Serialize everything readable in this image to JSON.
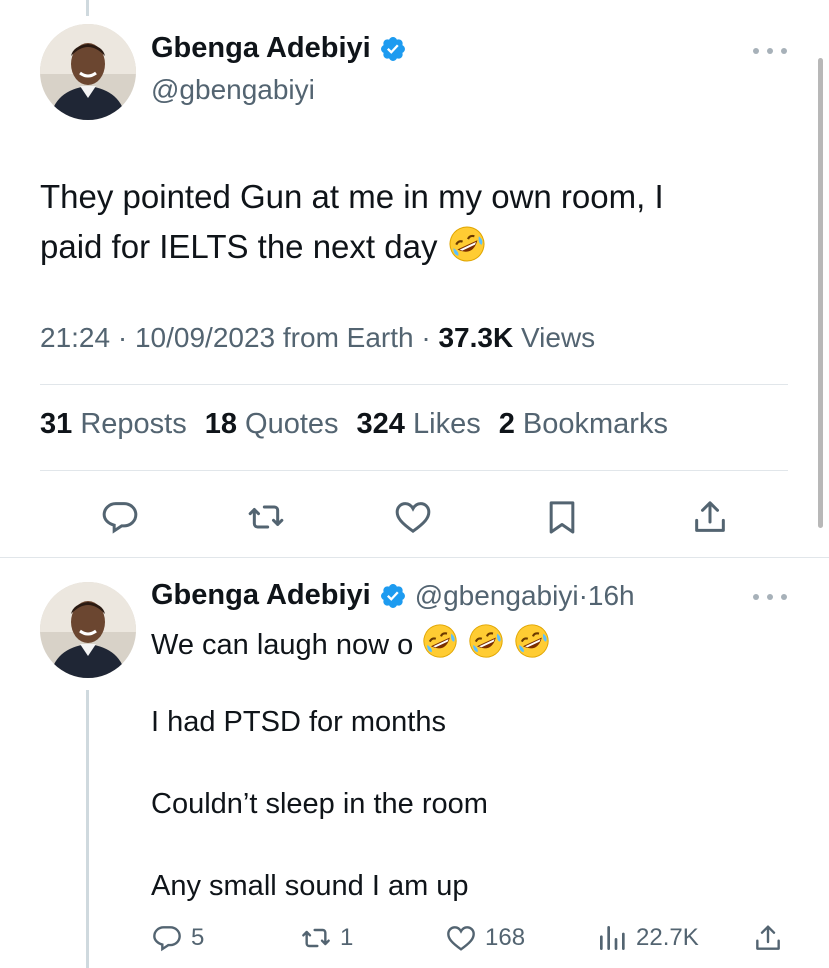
{
  "main_tweet": {
    "author": {
      "name": "Gbenga Adebiyi",
      "handle": "@gbengabiyi",
      "verified": true
    },
    "text_line1": "They pointed Gun at me in my own room, I",
    "text_line2": "paid for IELTS the next day",
    "emoji": "rolling-on-the-floor-laughing",
    "time": "21:24",
    "date": "10/09/2023",
    "source": "from Earth",
    "views_count": "37.3K",
    "views_label": "Views",
    "stats": {
      "reposts_count": "31",
      "reposts_label": "Reposts",
      "quotes_count": "18",
      "quotes_label": "Quotes",
      "likes_count": "324",
      "likes_label": "Likes",
      "bookmarks_count": "2",
      "bookmarks_label": "Bookmarks"
    }
  },
  "reply_tweet": {
    "author": {
      "name": "Gbenga Adebiyi",
      "handle": "@gbengabiyi",
      "verified": true
    },
    "age": "16h",
    "line1": "We can laugh now o",
    "line2": "I had PTSD for months",
    "line3": "Couldn’t sleep in the room",
    "line4": "Any small sound I am up",
    "actions": {
      "replies": "5",
      "reposts": "1",
      "likes": "168",
      "views": "22.7K"
    }
  },
  "colors": {
    "text_primary": "#0f1419",
    "text_secondary": "#536471",
    "verified_blue": "#1d9bf0",
    "divider": "#e1e6ea",
    "thread_line": "#cfd9de"
  }
}
